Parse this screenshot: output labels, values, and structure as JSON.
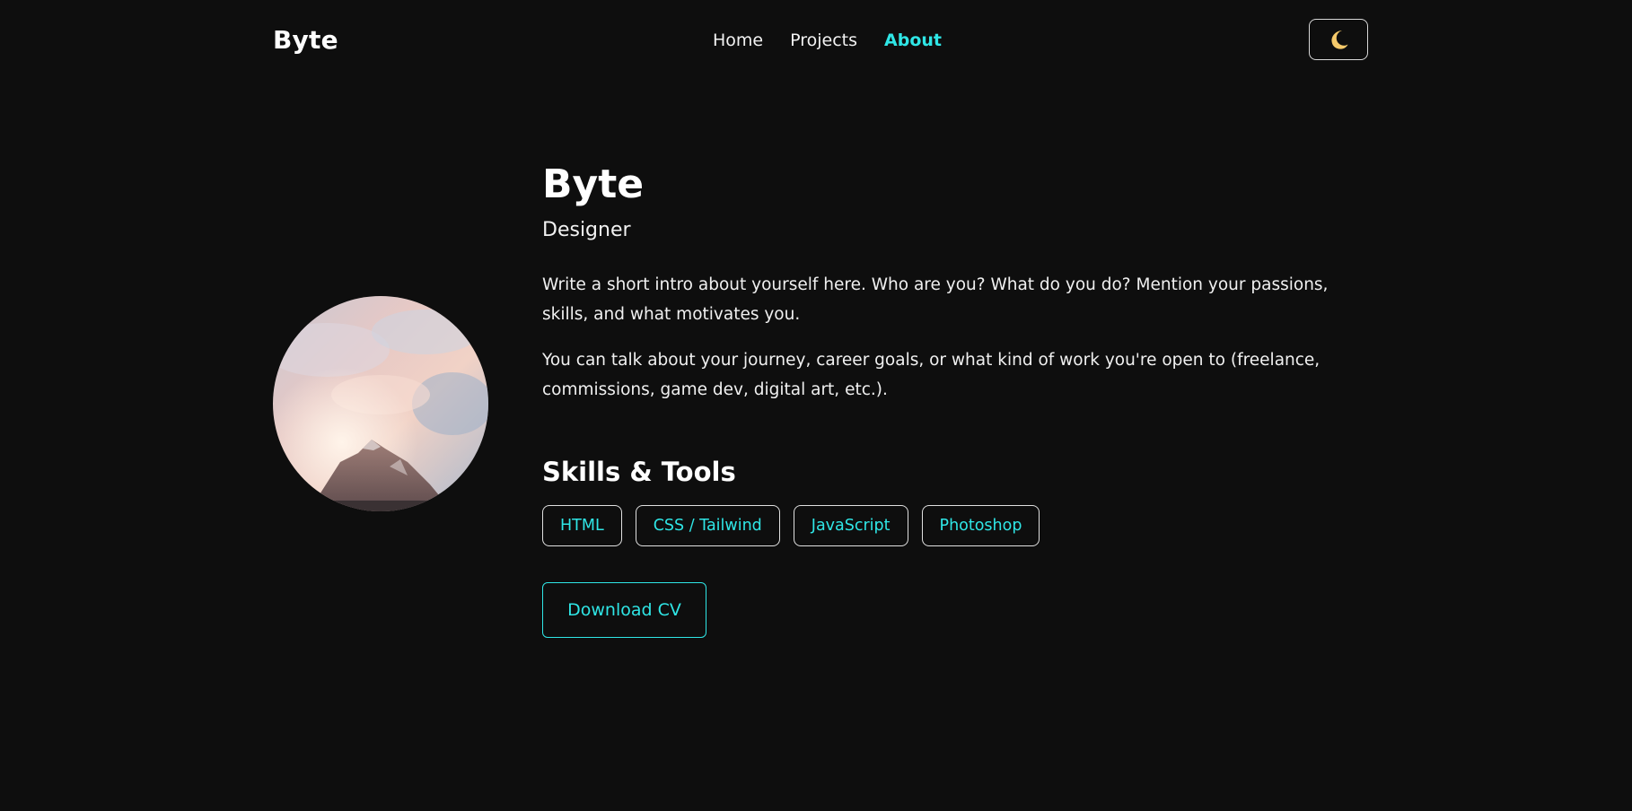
{
  "header": {
    "brand": "Byte",
    "nav": [
      {
        "label": "Home",
        "active": false
      },
      {
        "label": "Projects",
        "active": false
      },
      {
        "label": "About",
        "active": true
      }
    ],
    "theme_toggle_icon": "moon-icon"
  },
  "profile": {
    "name": "Byte",
    "role": "Designer",
    "intro_1": "Write a short intro about yourself here. Who are you? What do you do? Mention your passions, skills, and what motivates you.",
    "intro_2": "You can talk about your journey, career goals, or what kind of work you're open to (freelance, commissions, game dev, digital art, etc.)."
  },
  "skills": {
    "title": "Skills & Tools",
    "items": [
      "HTML",
      "CSS / Tailwind",
      "JavaScript",
      "Photoshop"
    ]
  },
  "cv_button": {
    "label": "Download CV"
  },
  "colors": {
    "background": "#0e0e0e",
    "accent": "#2fe6e6",
    "text": "#f2f2f2",
    "moon": "#f5c96a"
  }
}
